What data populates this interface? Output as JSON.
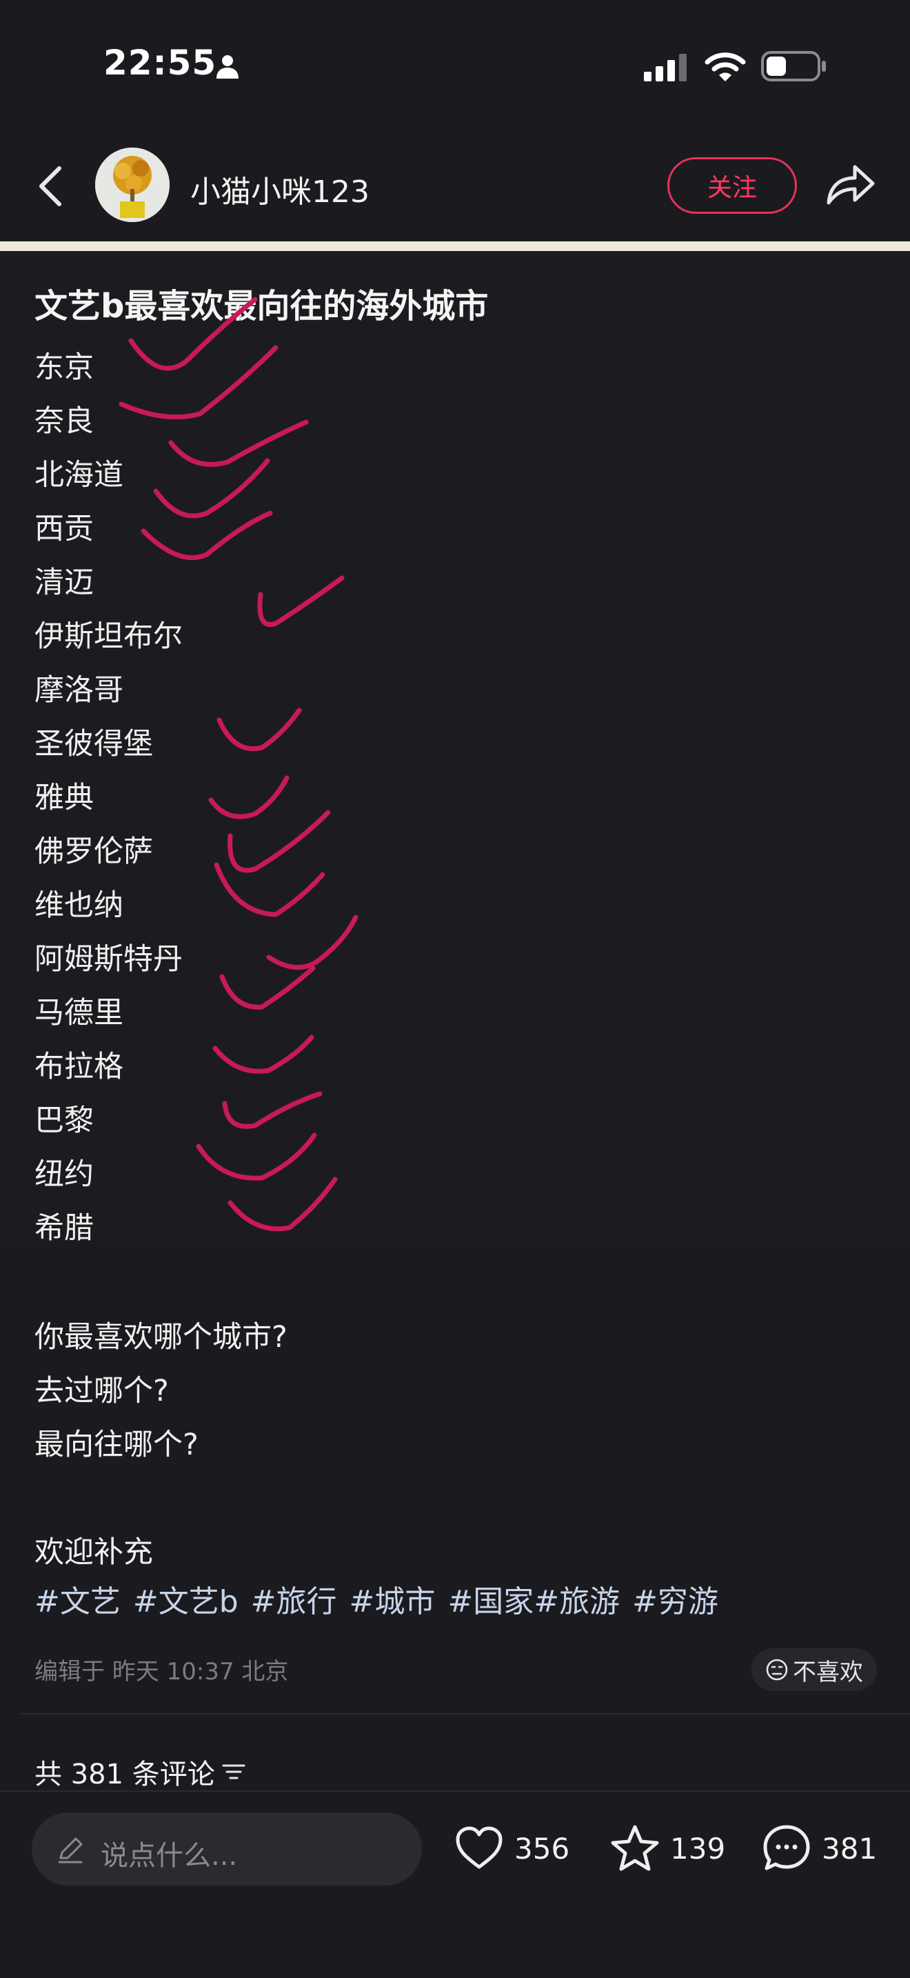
{
  "status_bar": {
    "time": "22:55",
    "icons": [
      "person-icon",
      "cellular-signal-icon",
      "wifi-icon",
      "battery-icon"
    ]
  },
  "header": {
    "author_name": "小猫小咪123",
    "follow_label": "关注",
    "icons": [
      "back-icon",
      "share-icon"
    ]
  },
  "note_image": {
    "title": "文艺b最喜欢最向往的海外城市",
    "cities": [
      "东京",
      "奈良",
      "北海道",
      "西贡",
      "清迈",
      "伊斯坦布尔",
      "摩洛哥",
      "圣彼得堡",
      "雅典",
      "佛罗伦萨",
      "维也纳",
      "阿姆斯特丹",
      "马德里",
      "布拉格",
      "巴黎",
      "纽约",
      "希腊"
    ],
    "check_color": "#c8195a"
  },
  "caption": {
    "lines": [
      "你最喜欢哪个城市?",
      "去过哪个?",
      "最向往哪个?",
      "",
      "欢迎补充"
    ],
    "tags": [
      "#文艺",
      "#文艺b",
      "#旅行",
      "#城市",
      "#国家#旅游",
      "#穷游"
    ]
  },
  "meta": {
    "edited": "编辑于  昨天 10:37  北京",
    "dislike_label": "不喜欢"
  },
  "comments": {
    "count_label": "共 381 条评论"
  },
  "bottom_bar": {
    "input_placeholder": "说点什么...",
    "likes": "356",
    "collects": "139",
    "comments": "381"
  },
  "colors": {
    "accent": "#ff3a63",
    "background": "#1b1b1f",
    "tag": "#c7d4ea"
  }
}
